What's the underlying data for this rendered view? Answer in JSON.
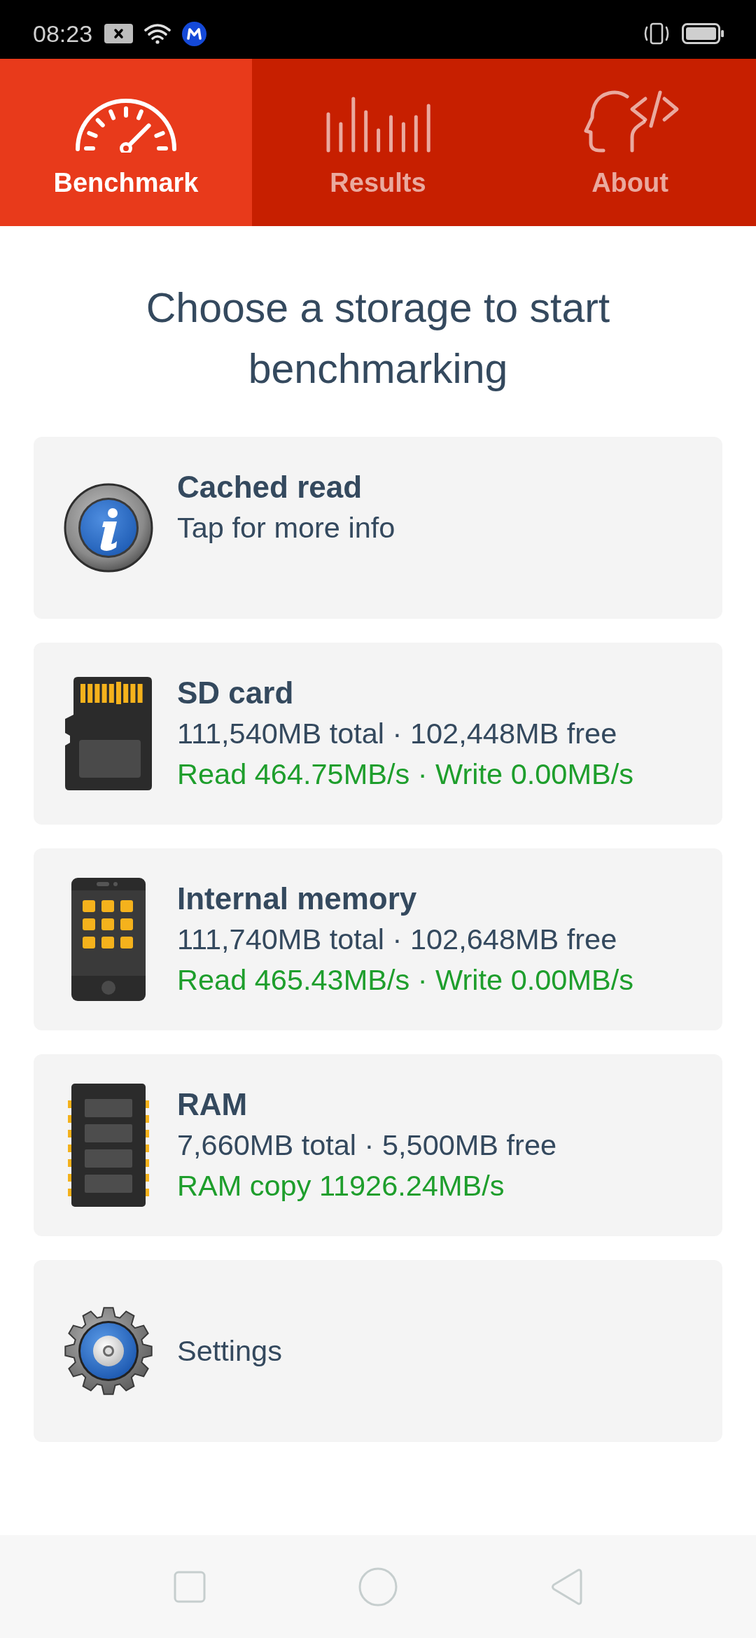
{
  "status_bar": {
    "time": "08:23"
  },
  "tabs": [
    {
      "label": "Benchmark",
      "selected": true
    },
    {
      "label": "Results",
      "selected": false
    },
    {
      "label": "About",
      "selected": false
    }
  ],
  "heading": "Choose a storage to start benchmarking",
  "items": [
    {
      "kind": "entry",
      "title": "Cached read",
      "detail": "Tap for more info"
    },
    {
      "kind": "entry",
      "title": "SD card",
      "detail": "111,540MB total · 102,448MB free",
      "speed": "Read 464.75MB/s · Write 0.00MB/s"
    },
    {
      "kind": "entry",
      "title": "Internal memory",
      "detail": "111,740MB total · 102,648MB free",
      "speed": "Read 465.43MB/s · Write 0.00MB/s"
    },
    {
      "kind": "entry",
      "title": "RAM",
      "detail": "7,660MB total · 5,500MB free",
      "speed": "RAM copy 11926.24MB/s"
    },
    {
      "kind": "setting",
      "title": "Settings"
    }
  ]
}
